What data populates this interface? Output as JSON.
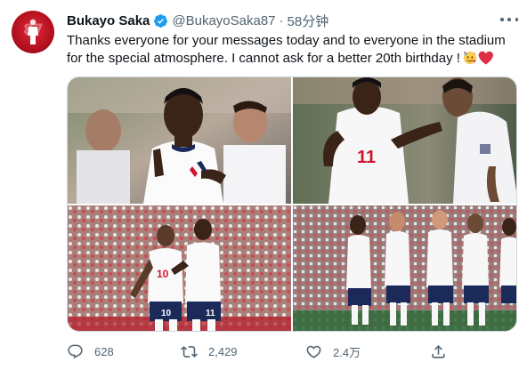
{
  "tweet": {
    "author": {
      "display_name": "Bukayo Saka",
      "handle": "@BukayoSaka87",
      "verified": true,
      "avatar_number": "87"
    },
    "separator": "·",
    "timestamp": "58分钟",
    "text_lines": [
      "Thanks everyone for your messages today and to everyone in the stadium",
      "for the special atmosphere. I cannot ask for a better 20th birthday !"
    ],
    "emojis": [
      "partying-face",
      "red-heart"
    ],
    "media": [
      {
        "id": "photo-1",
        "shirt_number": ""
      },
      {
        "id": "photo-2",
        "shirt_number": "11"
      },
      {
        "id": "photo-3",
        "shirt_numbers": [
          "10",
          "11"
        ]
      },
      {
        "id": "photo-4",
        "shirt_number": ""
      }
    ],
    "actions": {
      "reply_count": "628",
      "retweet_count": "2,429",
      "like_count": "2.4万"
    }
  },
  "colors": {
    "text_primary": "#0f1419",
    "text_secondary": "#536471",
    "verified_blue": "#1d9bf0",
    "avatar_red": "#c8102e",
    "heart_red": "#e0245e"
  },
  "icons": [
    "more-icon",
    "verified-icon",
    "reply-icon",
    "retweet-icon",
    "like-icon",
    "share-icon"
  ]
}
